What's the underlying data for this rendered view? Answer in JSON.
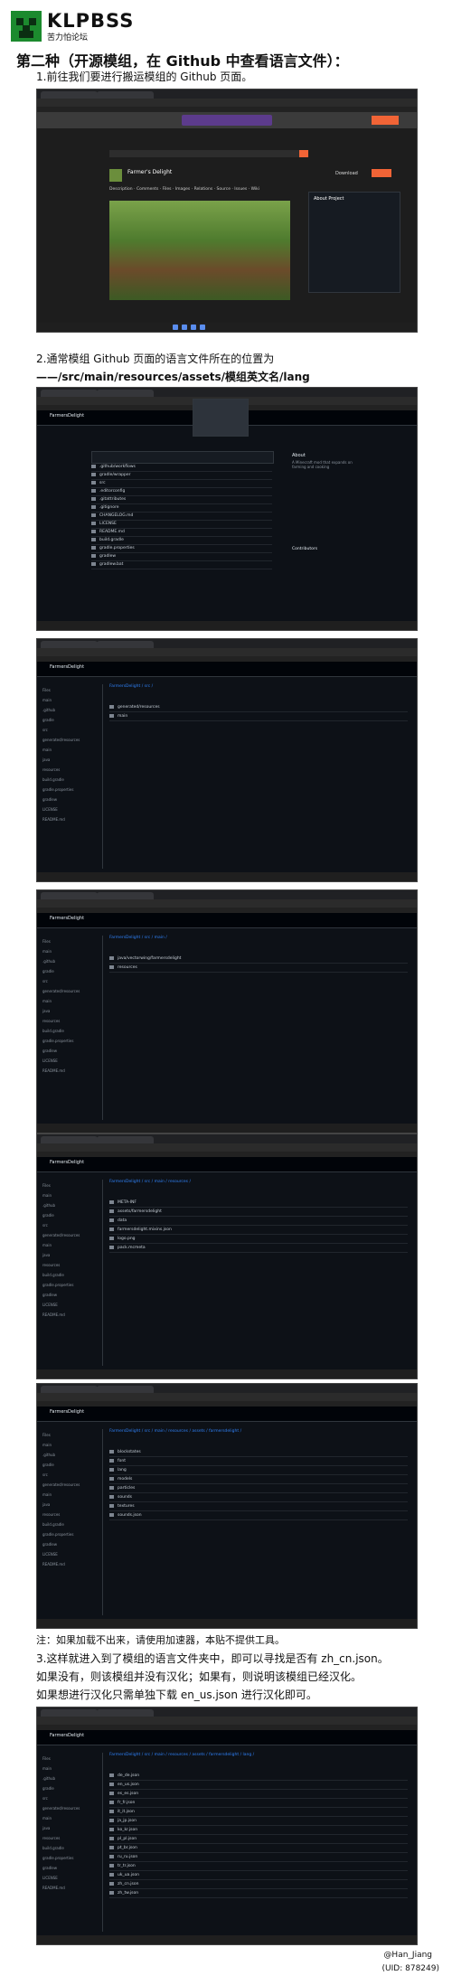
{
  "brand": {
    "title": "KLPBSS",
    "subtitle": "苦力怕论坛"
  },
  "heading": "第二种（开源模组，在 Github 中查看语言文件）：",
  "step1": "1.前往我们要进行搬运模组的 Github 页面。",
  "step2_line1": "2.通常模组 Github 页面的语言文件所在的位置为",
  "step2_line2": "——/src/main/resources/assets/模组英文名/lang",
  "note": "注：如果加载不出来，请使用加速器，本贴不提供工具。",
  "step3_line1": "3.这样就进入到了模组的语言文件夹中，即可以寻找是否有 zh_cn.json。",
  "step3_line2": "如果没有，则该模组并没有汉化；如果有，则说明该模组已经汉化。",
  "step3_line3": "如果想进行汉化只需单独下载 en_us.json 进行汉化即可。",
  "author": "@Han_Jiang",
  "uid": "(UID: 878249)",
  "shot1": {
    "page_title": "Farmer's Delight",
    "download_label": "Download",
    "tabs": [
      "Description",
      "Comments",
      "Files",
      "Images",
      "Relations",
      "Source",
      "Issues",
      "Wiki"
    ],
    "about_title": "About Project"
  },
  "shot2": {
    "repo": "FarmersDelight",
    "about_title": "About",
    "about_text": "A Minecraft mod that expands on farming and cooking",
    "contributors_title": "Contributors",
    "files": [
      ".github/workflows",
      "gradle/wrapper",
      "src",
      ".editorconfig",
      ".gitattributes",
      ".gitignore",
      "CHANGELOG.md",
      "LICENSE",
      "README.md",
      "build.gradle",
      "gradle.properties",
      "gradlew",
      "gradlew.bat"
    ]
  },
  "shot3": {
    "repo": "FarmersDelight",
    "path": "FarmersDelight / src /",
    "files": [
      "generated/resources",
      "main"
    ]
  },
  "shot4": {
    "repo": "FarmersDelight",
    "path": "FarmersDelight / src / main /",
    "files": [
      "java/vectorwing/farmersdelight",
      "resources"
    ]
  },
  "shot5": {
    "repo": "FarmersDelight",
    "path": "FarmersDelight / src / main / resources /",
    "files": [
      "META-INF",
      "assets/farmersdelight",
      "data",
      "farmersdelight.mixins.json",
      "logo.png",
      "pack.mcmeta"
    ]
  },
  "shot6": {
    "repo": "FarmersDelight",
    "path": "FarmersDelight / src / main / resources / assets / farmersdelight /",
    "files": [
      "blockstates",
      "font",
      "lang",
      "models",
      "particles",
      "sounds",
      "textures",
      "sounds.json"
    ]
  },
  "shot7": {
    "repo": "FarmersDelight",
    "path": "FarmersDelight / src / main / resources / assets / farmersdelight / lang /",
    "files": [
      "de_de.json",
      "en_us.json",
      "es_es.json",
      "fr_fr.json",
      "it_it.json",
      "ja_jp.json",
      "ko_kr.json",
      "pl_pl.json",
      "pt_br.json",
      "ru_ru.json",
      "tr_tr.json",
      "uk_ua.json",
      "zh_cn.json",
      "zh_tw.json"
    ]
  },
  "sidebar_items": [
    "Files",
    "main",
    ".github",
    "gradle",
    "src",
    "generated/resources",
    "main",
    "java",
    "resources",
    "build.gradle",
    "gradle.properties",
    "gradlew",
    "LICENSE",
    "README.md"
  ]
}
